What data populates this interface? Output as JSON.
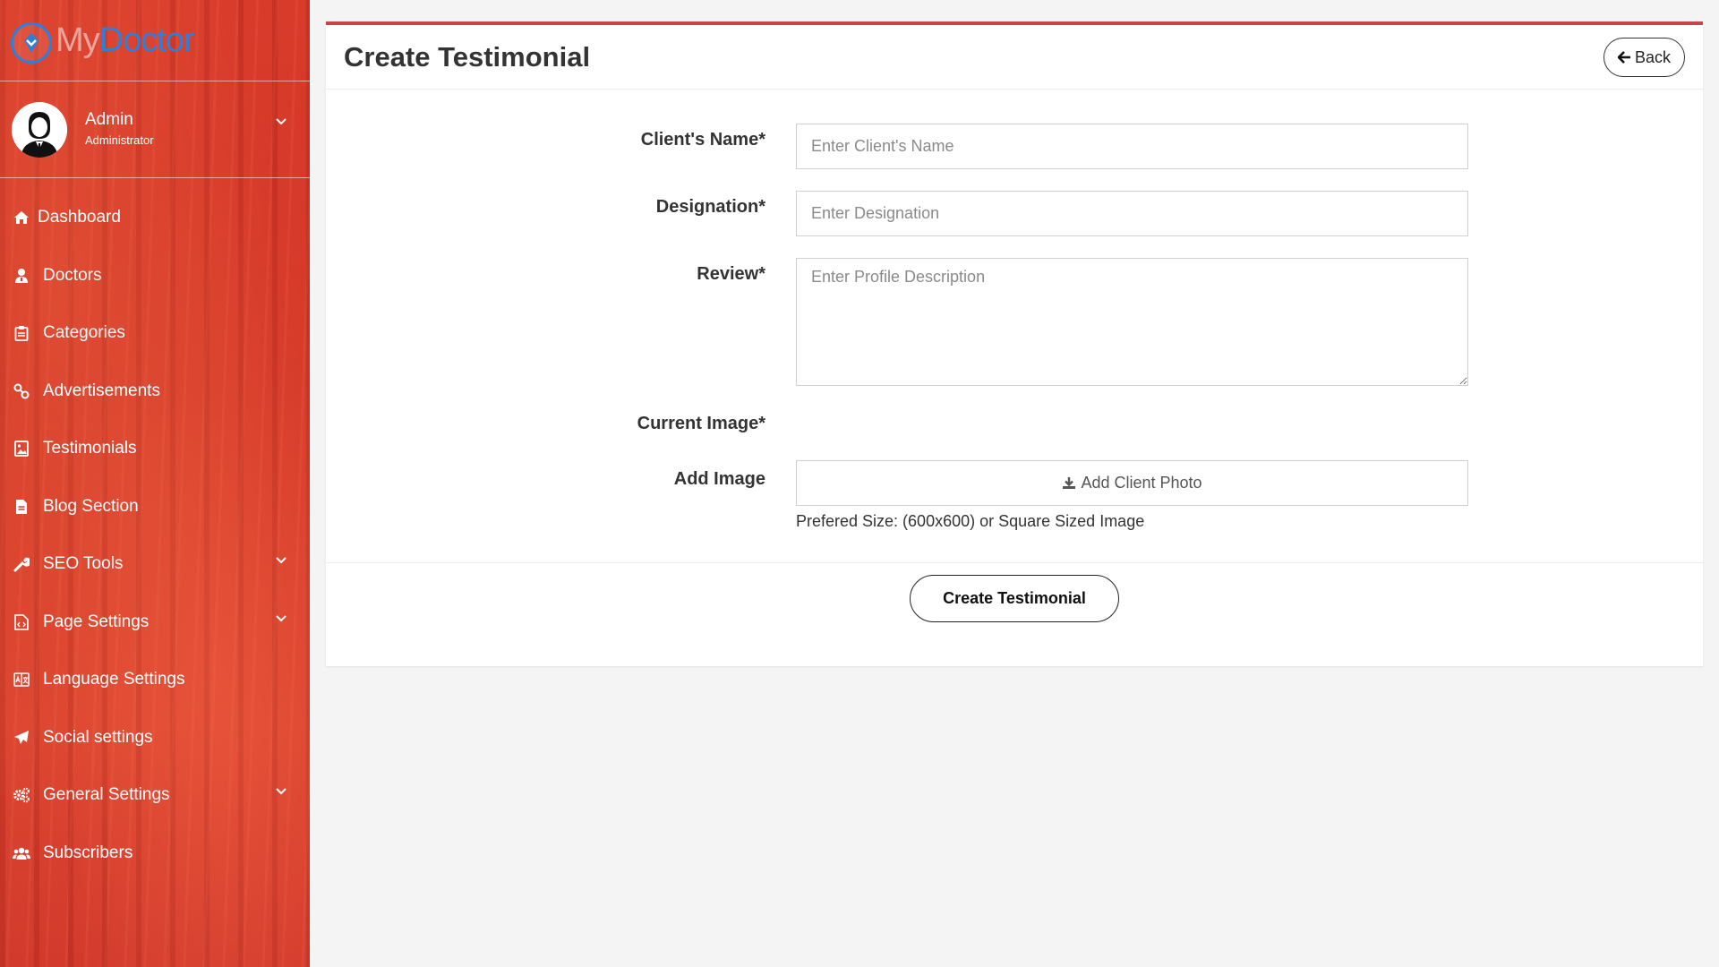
{
  "brand": {
    "logo_prefix": "My",
    "logo_suffix": "Doctor"
  },
  "user": {
    "name": "Admin",
    "role": "Administrator"
  },
  "sidebar": {
    "items": [
      {
        "label": "Dashboard",
        "icon": "home-icon",
        "has_submenu": false
      },
      {
        "label": "Doctors",
        "icon": "user-md-icon",
        "has_submenu": false
      },
      {
        "label": "Categories",
        "icon": "clipboard-icon",
        "has_submenu": false
      },
      {
        "label": "Advertisements",
        "icon": "link-icon",
        "has_submenu": false
      },
      {
        "label": "Testimonials",
        "icon": "image-icon",
        "has_submenu": false
      },
      {
        "label": "Blog Section",
        "icon": "file-icon",
        "has_submenu": false
      },
      {
        "label": "SEO Tools",
        "icon": "wrench-icon",
        "has_submenu": true
      },
      {
        "label": "Page Settings",
        "icon": "file-code-icon",
        "has_submenu": true
      },
      {
        "label": "Language Settings",
        "icon": "language-icon",
        "has_submenu": false
      },
      {
        "label": "Social settings",
        "icon": "paper-plane-icon",
        "has_submenu": false
      },
      {
        "label": "General Settings",
        "icon": "cogs-icon",
        "has_submenu": true
      },
      {
        "label": "Subscribers",
        "icon": "users-icon",
        "has_submenu": false
      }
    ]
  },
  "header": {
    "title": "Create Testimonial",
    "back_label": "Back"
  },
  "form": {
    "client_name": {
      "label": "Client's Name*",
      "placeholder": "Enter Client's Name",
      "value": ""
    },
    "designation": {
      "label": "Designation*",
      "placeholder": "Enter Designation",
      "value": ""
    },
    "review": {
      "label": "Review*",
      "placeholder": "Enter Profile Description",
      "value": ""
    },
    "current_image": {
      "label": "Current Image*"
    },
    "add_image": {
      "label": "Add Image",
      "button_label": "Add Client Photo",
      "help_text": "Prefered Size: (600x600) or Square Sized Image"
    },
    "submit_label": "Create Testimonial"
  },
  "colors": {
    "sidebar_red": "#d93b2b",
    "accent_border": "#c8434a",
    "logo_blue": "#2f7fd8"
  }
}
